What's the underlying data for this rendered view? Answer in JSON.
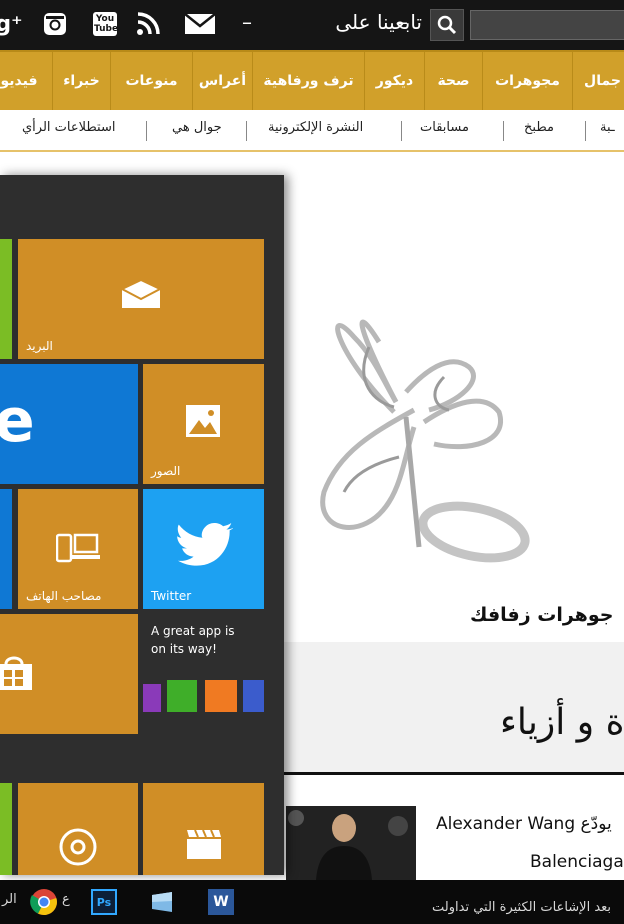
{
  "topbar": {
    "follow_label": "تابعينا على",
    "dash_left": "–",
    "dash_right": "–",
    "icons": [
      "google-plus-icon",
      "instagram-icon",
      "youtube-icon",
      "rss-icon",
      "mail-icon",
      "search-icon"
    ],
    "youtube_text": "You Tube",
    "gplus_text": "g⁺"
  },
  "nav": {
    "items": [
      "جمال",
      "مجوهرات",
      "صحة",
      "ديكور",
      "ترف ورفاهية",
      "أعراس",
      "منوعات",
      "خبراء",
      "فيديو"
    ]
  },
  "subnav": {
    "items": [
      "ـبة",
      "مطبخ",
      "مسابقات",
      "النشرة الإلكترونية",
      "جوال هي",
      "استطلاعات الرأي"
    ]
  },
  "article": {
    "headline": "جوهرات زفافك",
    "section_title": "ة و أزياء",
    "news_line1": "Alexander Wang يودّع",
    "news_line2": "Balenciaga",
    "footer_snippet": "بعد الإشاعات الكثيرة التي تداولت"
  },
  "start_menu": {
    "tiles": {
      "mail": "البريد",
      "edge": "e",
      "photos": "الصور",
      "phone": "مصاحب الهاتف",
      "twitter": "Twitter",
      "store_line1": "A great app is",
      "store_line2": "on its way!"
    }
  },
  "taskbar": {
    "left_text": "الر",
    "left_text2": "ع",
    "ps_label": "Ps",
    "word_label": "W"
  },
  "colors": {
    "gold": "#d1a02a",
    "tile_orange": "#d08e26",
    "edge_blue": "#0f78d4",
    "twitter_blue": "#1da1f2",
    "green": "#7bbd25",
    "topbar": "#151515",
    "start_bg": "#2e2e2e"
  }
}
